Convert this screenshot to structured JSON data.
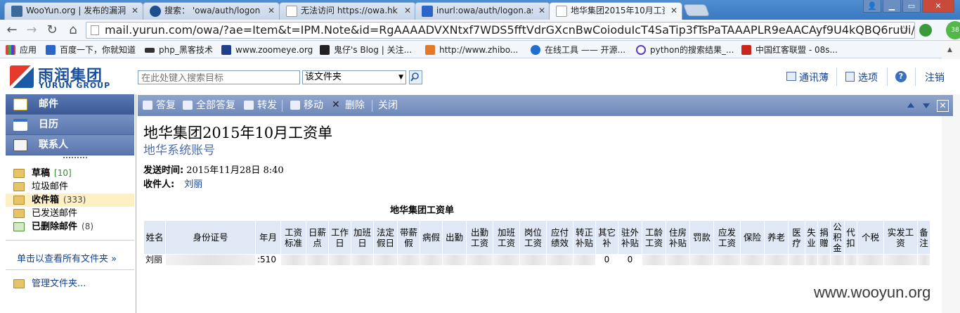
{
  "browser": {
    "tabs": [
      {
        "title": "WooYun.org | 发布的漏洞",
        "active": false
      },
      {
        "title": "搜索： 'owa/auth/logon",
        "active": false
      },
      {
        "title": "无法访问 https://owa.hk",
        "active": false
      },
      {
        "title": "inurl:owa/auth/logon.as",
        "active": false
      },
      {
        "title": "地华集团2015年10月工资",
        "active": true
      }
    ],
    "address_url": "mail.yurun.com/owa/?ae=Item&t=IPM.Note&id=RgAAAADVXNtxf7WDS5fftVdrGXcnBwCoioduIcT4SaTip3fTsPaTAAAPLR9eAACAyf9U4kQBQ6ruUi/",
    "bookmarks": [
      "应用",
      "百度一下，你就知道",
      "php_黑客技术",
      "www.zoomeye.org",
      "鬼仔's Blog | 关注...",
      "http://www.zhibo...",
      "在线工具 —— 开源...",
      "python的搜索结果_...",
      "中国红客联盟 - 08s..."
    ],
    "badge": "38"
  },
  "owa_header": {
    "logo_text": "雨润集团",
    "logo_sub": "YURUN GROUP",
    "search_placeholder": "在此处键入搜索目标",
    "search_scope": "该文件夹",
    "address_book": "通讯薄",
    "options": "选项",
    "help": "?",
    "logout": "注销"
  },
  "left_nav": {
    "modules": [
      "邮件",
      "日历",
      "联系人"
    ],
    "folders": [
      {
        "name": "草稿",
        "count": "[10]",
        "bold": true,
        "selected": false
      },
      {
        "name": "垃圾邮件",
        "count": "",
        "bold": false,
        "selected": false
      },
      {
        "name": "收件箱",
        "count": "(333)",
        "bold": true,
        "selected": true
      },
      {
        "name": "已发送邮件",
        "count": "",
        "bold": false,
        "selected": false
      },
      {
        "name": "已删除邮件",
        "count": "(8)",
        "bold": true,
        "selected": false
      }
    ],
    "view_all": "单击以查看所有文件夹 »",
    "manage": "管理文件夹..."
  },
  "reading_toolbar": {
    "reply": "答复",
    "reply_all": "全部答复",
    "forward": "转发",
    "move": "移动",
    "delete": "删除",
    "close": "关闭"
  },
  "message": {
    "subject": "地华集团2015年10月工资单",
    "sender": "地华系统账号",
    "sent_label": "发送时间:",
    "sent_time": "2015年11月28日 8:40",
    "to_label": "收件人:",
    "to_name": "刘丽",
    "table_title": "地华集团工资单",
    "columns": [
      "姓名",
      "身份证号",
      "年月",
      "工资标准",
      "日薪点",
      "工作日",
      "加班日",
      "法定假日",
      "带薪假",
      "病假",
      "出勤",
      "出勤工资",
      "加班工资",
      "岗位工资",
      "应付绩效",
      "转正补贴",
      "其它补",
      "驻外补贴",
      "工龄工资",
      "住房补贴",
      "罚款",
      "应发工资",
      "保险",
      "养老",
      "医疗",
      "失业",
      "捐赠",
      "公积金",
      "代扣",
      "个税",
      "实发工资",
      "备注"
    ],
    "row": [
      "刘丽",
      "",
      ":510",
      "",
      "",
      "",
      "",
      "",
      "",
      "",
      "",
      "",
      "",
      "",
      "",
      "",
      "0",
      "0",
      "",
      "",
      "",
      "",
      "",
      "",
      "",
      "",
      "",
      "",
      "",
      "",
      "",
      ""
    ]
  },
  "watermark": "www.wooyun.org"
}
